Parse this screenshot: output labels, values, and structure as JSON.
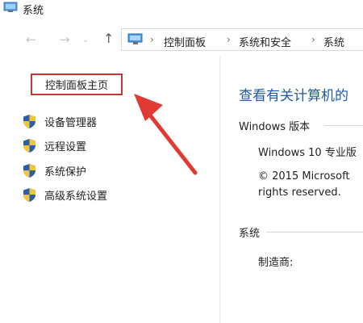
{
  "window": {
    "title": "系统",
    "icon": "monitor-icon"
  },
  "address_bar": {
    "icon": "control-panel-icon",
    "breadcrumbs": [
      "控制面板",
      "系统和安全",
      "系统"
    ],
    "separator": "›",
    "back": "←",
    "forward": "→",
    "up": "↑"
  },
  "sidebar": {
    "home_link": "控制面板主页",
    "items": [
      {
        "label": "设备管理器",
        "icon": "uac-shield-icon"
      },
      {
        "label": "远程设置",
        "icon": "uac-shield-icon"
      },
      {
        "label": "系统保护",
        "icon": "uac-shield-icon"
      },
      {
        "label": "高级系统设置",
        "icon": "uac-shield-icon"
      }
    ]
  },
  "main": {
    "title": "查看有关计算机的",
    "windows_edition": {
      "heading": "Windows 版本",
      "edition": "Windows 10 专业版",
      "copyright_line1": "© 2015 Microsoft",
      "copyright_line2": "rights reserved."
    },
    "system": {
      "heading": "系统",
      "manufacturer_label": "制造商:"
    }
  },
  "colors": {
    "highlight_box": "#c73535",
    "arrow": "#e03a32",
    "title_blue": "#1e5aa8"
  }
}
